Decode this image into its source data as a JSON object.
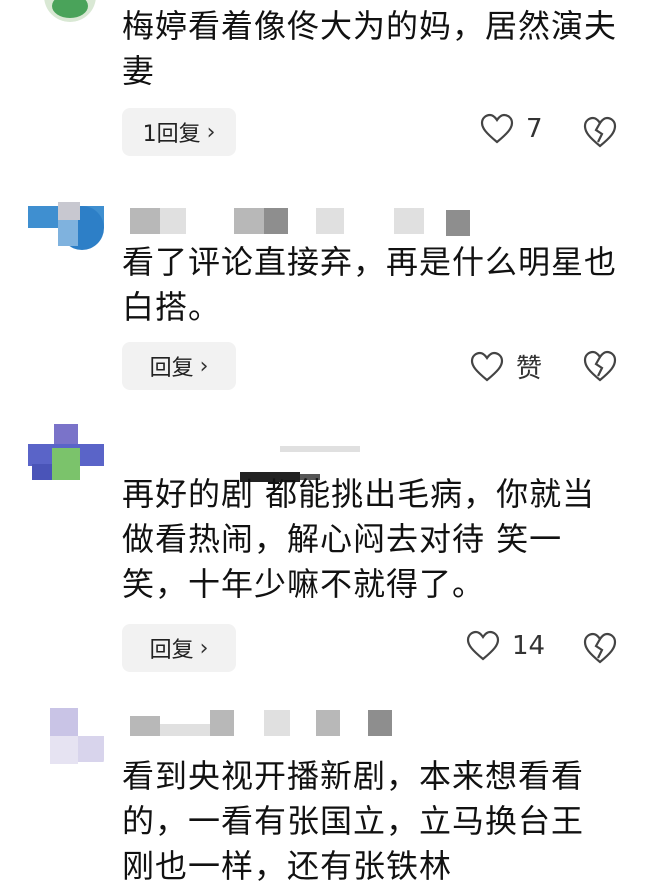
{
  "comments": [
    {
      "text": "梅婷看着像佟大为的妈，居然演夫妻",
      "reply_label": "1回复",
      "like_label": "7"
    },
    {
      "text": "看了评论直接弃，再是什么明星也白搭。",
      "reply_label": "回复",
      "like_label": "赞"
    },
    {
      "text": "再好的剧 都能挑出毛病，你就当做看热闹，解心闷去对待 笑一笑，十年少嘛不就得了。",
      "reply_label": "回复",
      "like_label": "14"
    },
    {
      "text": "看到央视开播新剧，本来想看看的，一看有张国立，立马换台王刚也一样，还有张铁林"
    }
  ],
  "icons": {
    "like": "heart-outline-icon",
    "dislike": "broken-heart-icon",
    "chevron": "chevron-right-icon"
  }
}
